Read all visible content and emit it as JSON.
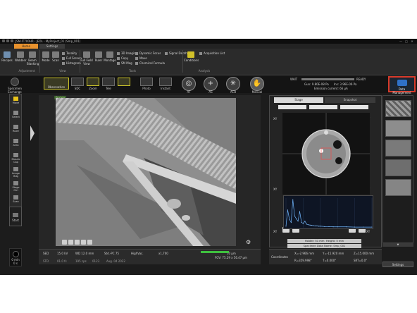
{
  "window": {
    "title": "JSM-IT700HR - JEOL - MyProject_01 (Smp_001)",
    "controls": [
      "—",
      "□",
      "✕"
    ]
  },
  "ribbon": {
    "tabs": [
      "Home",
      "Settings"
    ],
    "buttons": {
      "recipes": "Recipes",
      "wobbler": "Wobbler",
      "beam_blanking": "Beam Blanking",
      "mode": "Mode",
      "scan": "Scan",
      "full_field_view": "Full Field View",
      "ruler": "Ruler",
      "montage": "Montage",
      "conditions": "Conditions"
    },
    "small_items": {
      "tonality": "Tonality",
      "full_screen": "Full Screen",
      "histogram": "Histogram",
      "imaging_3d": "3D Imaging",
      "copy": "Copy",
      "sm_mag": "SM Mag",
      "dynamic_focus": "Dynamic Focus",
      "move": "Move",
      "chemical_formula": "Chemical Formula",
      "signal_depth": "Signal Depth",
      "acquisition_list": "Acquisition List"
    },
    "groups": [
      "Adjustment",
      "View",
      "Tools",
      "Analysis"
    ]
  },
  "toolbar": {
    "specimen_exchange": "Specimen Exchange",
    "observation": "Observation",
    "sdc": "SDC",
    "zoom": "Zoom",
    "tele": "Tele",
    "photo": "Photo",
    "instant": "Instant",
    "af": "AF",
    "as": "AS",
    "acb": "ACB",
    "manual": "Manual",
    "status": {
      "wait": "WAIT",
      "ready": "READY",
      "gun": "Gun: 9.80E-08 Pa",
      "ins": "Ins: 3.96E-06 Pa",
      "emission": "Emission current: 66 μA"
    },
    "data_management": "Data Management"
  },
  "left_tools": [
    "Move",
    "Select",
    "Ruler",
    "Area",
    "Mosaic Cap",
    "Image Bdg",
    "Stage Ctrl",
    "Scan"
  ],
  "left_panel": {
    "start": "Start",
    "timer_min": "0 min",
    "timer_s": "0 s"
  },
  "viewer": {
    "badge": "Frozen"
  },
  "info_bar": {
    "detector": "SED",
    "kv": "15.0 kV",
    "wd": "WD 12.0 mm",
    "std": "Std.-PC 75",
    "vac": "HighVac.",
    "mag": "x1,700",
    "scale": "10 μm",
    "fov": "FOV: 75.29 x 56.47 μm",
    "row2": [
      "STD",
      "01.0 fs",
      "195 cps",
      "0123",
      "Aug. 04 2022"
    ]
  },
  "stage": {
    "tabs": [
      "Stage",
      "Snapshot"
    ],
    "holder": "Holder: 51 mm",
    "height": "Height: 5 mm",
    "specimen_name": "Specimen Data Name: Smp_001",
    "coordinates_label": "Coordinates",
    "x": "X=-2.966 mm",
    "y": "Y=-15.920 mm",
    "z": "Z=15.000 mm",
    "r": "R=359.998°",
    "t": "T=0.000°",
    "sr": "SRT=0.0°"
  },
  "thumbs": {
    "settings": "Settings"
  },
  "chart_data": {
    "type": "line",
    "x": [
      0,
      0.2,
      0.4,
      0.6,
      0.8,
      1.0,
      1.2,
      1.4,
      1.6,
      1.8,
      2.0,
      2.2,
      2.4,
      2.6,
      2.8,
      3.0,
      3.2,
      3.4,
      3.6,
      3.8,
      4.0,
      4.5,
      5.0,
      5.5,
      6.0,
      7.0,
      8.0,
      9.0,
      10.0
    ],
    "values": [
      5,
      60,
      28,
      18,
      95,
      40,
      30,
      22,
      55,
      18,
      14,
      22,
      12,
      10,
      9,
      8,
      7,
      6,
      6,
      5,
      5,
      4,
      4,
      3,
      3,
      3,
      2,
      2,
      2
    ],
    "xlim": [
      0,
      10
    ],
    "ylim": [
      0,
      100
    ],
    "title": "",
    "xlabel": "",
    "ylabel": ""
  }
}
